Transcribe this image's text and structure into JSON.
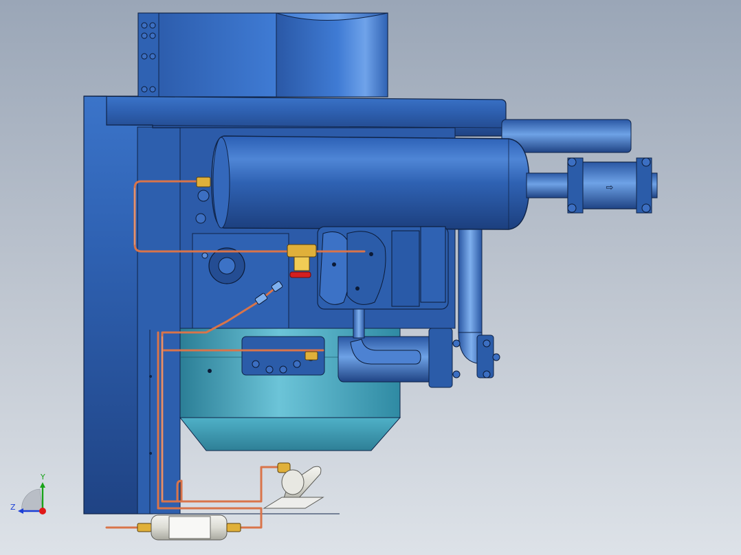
{
  "viewport": {
    "background_top": "#9aa6b7",
    "background_bottom": "#dde2e8"
  },
  "colors": {
    "steel_blue": "#2f62b3",
    "steel_blue_dark": "#1f4384",
    "steel_blue_light": "#5f92e0",
    "teal_tank": "#4fb1c8",
    "copper_pipe": "#d9744a",
    "brass_fitting": "#e0b03a",
    "valve_red": "#d41f1f"
  },
  "parts": {
    "flow_direction_symbol": "⇨"
  },
  "orientation_triad": {
    "x_label": "",
    "y_label": "Y",
    "z_label": "Z",
    "y_axis_color": "#19a319",
    "z_axis_color": "#1c3fd6",
    "origin_color": "#e01818"
  }
}
